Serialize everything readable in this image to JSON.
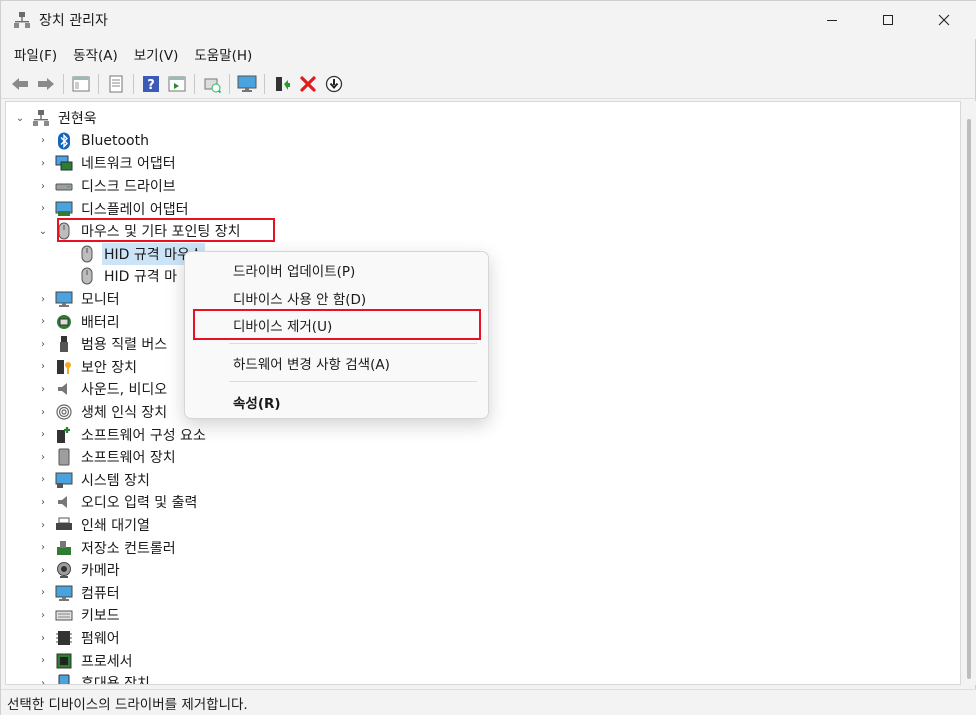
{
  "window": {
    "title": "장치 관리자"
  },
  "menu": [
    "파일(F)",
    "동작(A)",
    "보기(V)",
    "도움말(H)"
  ],
  "tree": {
    "root": "권현욱",
    "categories": [
      {
        "label": "Bluetooth",
        "icon": "bluetooth-icon",
        "expanded": false
      },
      {
        "label": "네트워크 어댑터",
        "icon": "network-adapter-icon",
        "expanded": false
      },
      {
        "label": "디스크 드라이브",
        "icon": "disk-drive-icon",
        "expanded": false
      },
      {
        "label": "디스플레이 어댑터",
        "icon": "display-adapter-icon",
        "expanded": false
      },
      {
        "label": "마우스 및 기타 포인팅 장치",
        "icon": "mouse-icon",
        "expanded": true,
        "children": [
          "HID 규격 마우스",
          "HID 규격 마"
        ]
      },
      {
        "label": "모니터",
        "icon": "monitor-icon",
        "expanded": false
      },
      {
        "label": "배터리",
        "icon": "battery-icon",
        "expanded": false
      },
      {
        "label": "범용 직렬 버스",
        "icon": "usb-icon",
        "expanded": false
      },
      {
        "label": "보안 장치",
        "icon": "security-device-icon",
        "expanded": false
      },
      {
        "label": "사운드, 비디오",
        "icon": "sound-icon",
        "expanded": false
      },
      {
        "label": "생체 인식 장치",
        "icon": "biometric-icon",
        "expanded": false
      },
      {
        "label": "소프트웨어 구성 요소",
        "icon": "software-component-icon",
        "expanded": false
      },
      {
        "label": "소프트웨어 장치",
        "icon": "software-device-icon",
        "expanded": false
      },
      {
        "label": "시스템 장치",
        "icon": "system-device-icon",
        "expanded": false
      },
      {
        "label": "오디오 입력 및 출력",
        "icon": "audio-io-icon",
        "expanded": false
      },
      {
        "label": "인쇄 대기열",
        "icon": "print-queue-icon",
        "expanded": false
      },
      {
        "label": "저장소 컨트롤러",
        "icon": "storage-controller-icon",
        "expanded": false
      },
      {
        "label": "카메라",
        "icon": "camera-icon",
        "expanded": false
      },
      {
        "label": "컴퓨터",
        "icon": "computer-icon",
        "expanded": false
      },
      {
        "label": "키보드",
        "icon": "keyboard-icon",
        "expanded": false
      },
      {
        "label": "펌웨어",
        "icon": "firmware-icon",
        "expanded": false
      },
      {
        "label": "프로세서",
        "icon": "processor-icon",
        "expanded": false
      },
      {
        "label": "휴대용 장치",
        "icon": "portable-device-icon",
        "expanded": false
      }
    ]
  },
  "context_menu": {
    "items": [
      {
        "label": "드라이버 업데이트(P)"
      },
      {
        "label": "디바이스 사용 안 함(D)"
      },
      {
        "label": "디바이스 제거(U)",
        "highlighted": true
      },
      {
        "label": "하드웨어 변경 사항 검색(A)"
      },
      {
        "label": "속성(R)",
        "bold": true
      }
    ]
  },
  "status_bar": "선택한 디바이스의 드라이버를 제거합니다.",
  "colors": {
    "highlight": "#e81123",
    "selection": "#cce4f7"
  }
}
